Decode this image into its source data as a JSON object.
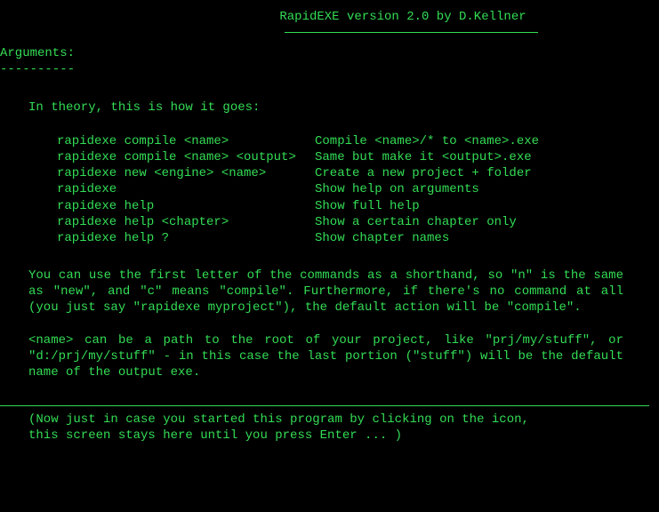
{
  "header": {
    "title": "RapidEXE version 2.0 by D.Kellner"
  },
  "section": {
    "heading": "Arguments:",
    "underline": "----------"
  },
  "intro": "In theory, this is how it goes:",
  "commands": [
    {
      "cmd": "rapidexe compile <name>",
      "desc": "Compile <name>/* to <name>.exe"
    },
    {
      "cmd": "rapidexe compile <name> <output>",
      "desc": "Same but make it <output>.exe"
    },
    {
      "cmd": "rapidexe new <engine> <name>",
      "desc": "Create a new project + folder"
    },
    {
      "cmd": "rapidexe",
      "desc": "Show help on arguments"
    },
    {
      "cmd": "rapidexe help",
      "desc": "Show full help"
    },
    {
      "cmd": "rapidexe help <chapter>",
      "desc": "Show a certain chapter only"
    },
    {
      "cmd": "rapidexe help ?",
      "desc": "Show chapter names"
    }
  ],
  "paragraphs": [
    "You can use the first letter of the commands as a shorthand, so \"n\" is the same as \"new\", and \"c\" means \"compile\". Furthermore, if there's no command at all (you just say \"rapidexe myproject\"), the default action will be \"compile\".",
    "<name> can be a path to the root of your project, like \"prj/my/stuff\", or \"d:/prj/my/stuff\" - in this case the last portion (\"stuff\") will be the default name of the output exe."
  ],
  "footer": {
    "line1": "(Now just in case you started this program by clicking on the icon,",
    "line2": "this screen stays here until you press Enter ... )"
  }
}
